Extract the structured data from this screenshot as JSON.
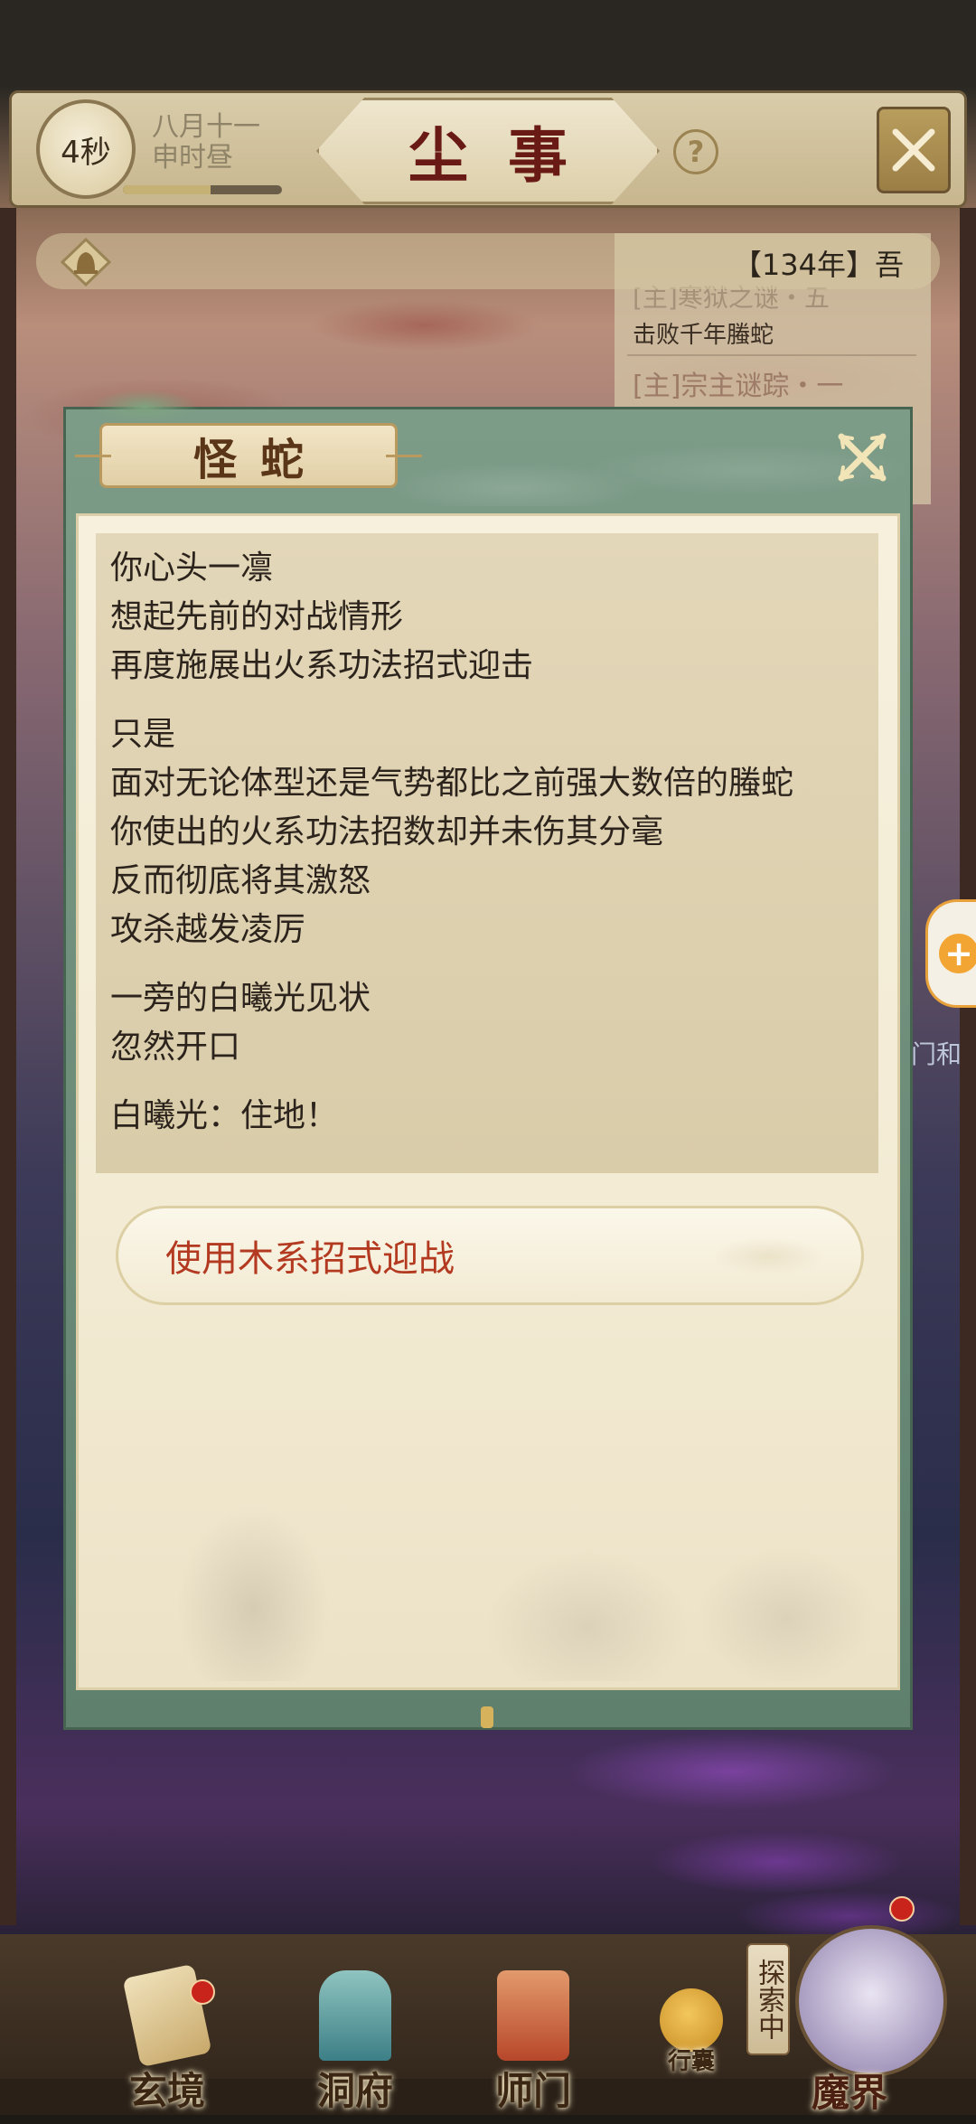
{
  "header": {
    "timer": "4秒",
    "date_line1": "八月十一",
    "date_line2": "申时昼",
    "time_progress": 0.55,
    "title": "尘事",
    "help_label": "?"
  },
  "notice": {
    "text": "【134年】吾"
  },
  "quests": {
    "line1": "[主]寒狱之谜・五",
    "line2": "击败千年螣蛇",
    "line3": "[主]宗主谜踪・一"
  },
  "dialog": {
    "title": "怪蛇",
    "paragraphs": [
      [
        "你心头一凛",
        "想起先前的对战情形",
        "再度施展出火系功法招式迎击"
      ],
      [
        "只是",
        "面对无论体型还是气势都比之前强大数倍的螣蛇",
        "你使出的火系功法招数却并未伤其分毫",
        "反而彻底将其激怒",
        "攻杀越发凌厉"
      ],
      [
        "一旁的白曦光见状",
        "忽然开口"
      ],
      [
        "白曦光：住地！"
      ]
    ],
    "choice": "使用木系招式迎战"
  },
  "side": {
    "plus": "+",
    "partial_text": "门和"
  },
  "nav": {
    "items": [
      {
        "label": "玄境"
      },
      {
        "label": "洞府"
      },
      {
        "label": "师门"
      },
      {
        "label": "行囊"
      },
      {
        "label": "魔界"
      }
    ],
    "explore_tag": "探索中"
  },
  "colors": {
    "title_red": "#6a1a14",
    "choice_red": "#b33a20",
    "frame_green": "#6f8f7b",
    "paper": "#f3ebd4"
  }
}
